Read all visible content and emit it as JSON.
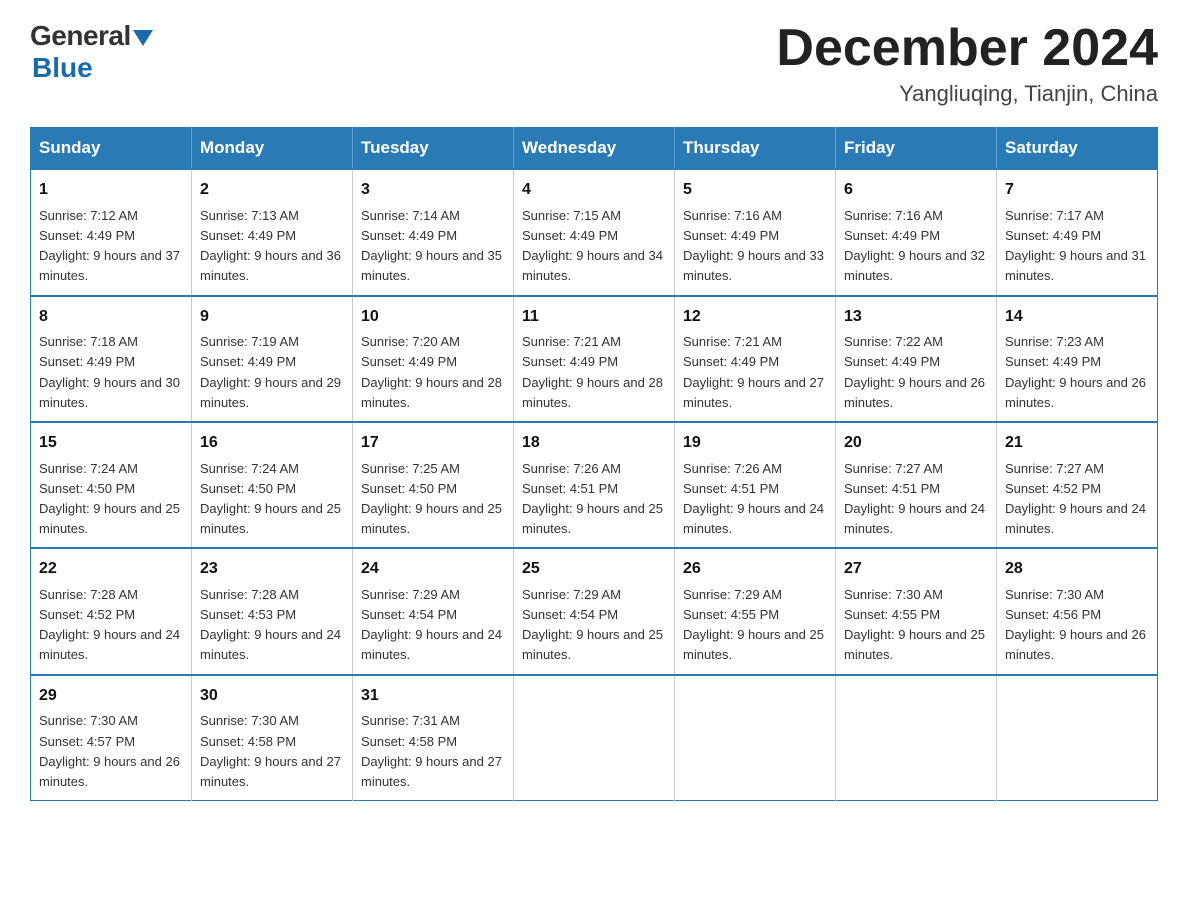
{
  "header": {
    "logo_general": "General",
    "logo_blue": "Blue",
    "month_title": "December 2024",
    "location": "Yangliuqing, Tianjin, China"
  },
  "days_of_week": [
    "Sunday",
    "Monday",
    "Tuesday",
    "Wednesday",
    "Thursday",
    "Friday",
    "Saturday"
  ],
  "weeks": [
    [
      {
        "day": "1",
        "sunrise": "7:12 AM",
        "sunset": "4:49 PM",
        "daylight": "9 hours and 37 minutes."
      },
      {
        "day": "2",
        "sunrise": "7:13 AM",
        "sunset": "4:49 PM",
        "daylight": "9 hours and 36 minutes."
      },
      {
        "day": "3",
        "sunrise": "7:14 AM",
        "sunset": "4:49 PM",
        "daylight": "9 hours and 35 minutes."
      },
      {
        "day": "4",
        "sunrise": "7:15 AM",
        "sunset": "4:49 PM",
        "daylight": "9 hours and 34 minutes."
      },
      {
        "day": "5",
        "sunrise": "7:16 AM",
        "sunset": "4:49 PM",
        "daylight": "9 hours and 33 minutes."
      },
      {
        "day": "6",
        "sunrise": "7:16 AM",
        "sunset": "4:49 PM",
        "daylight": "9 hours and 32 minutes."
      },
      {
        "day": "7",
        "sunrise": "7:17 AM",
        "sunset": "4:49 PM",
        "daylight": "9 hours and 31 minutes."
      }
    ],
    [
      {
        "day": "8",
        "sunrise": "7:18 AM",
        "sunset": "4:49 PM",
        "daylight": "9 hours and 30 minutes."
      },
      {
        "day": "9",
        "sunrise": "7:19 AM",
        "sunset": "4:49 PM",
        "daylight": "9 hours and 29 minutes."
      },
      {
        "day": "10",
        "sunrise": "7:20 AM",
        "sunset": "4:49 PM",
        "daylight": "9 hours and 28 minutes."
      },
      {
        "day": "11",
        "sunrise": "7:21 AM",
        "sunset": "4:49 PM",
        "daylight": "9 hours and 28 minutes."
      },
      {
        "day": "12",
        "sunrise": "7:21 AM",
        "sunset": "4:49 PM",
        "daylight": "9 hours and 27 minutes."
      },
      {
        "day": "13",
        "sunrise": "7:22 AM",
        "sunset": "4:49 PM",
        "daylight": "9 hours and 26 minutes."
      },
      {
        "day": "14",
        "sunrise": "7:23 AM",
        "sunset": "4:49 PM",
        "daylight": "9 hours and 26 minutes."
      }
    ],
    [
      {
        "day": "15",
        "sunrise": "7:24 AM",
        "sunset": "4:50 PM",
        "daylight": "9 hours and 25 minutes."
      },
      {
        "day": "16",
        "sunrise": "7:24 AM",
        "sunset": "4:50 PM",
        "daylight": "9 hours and 25 minutes."
      },
      {
        "day": "17",
        "sunrise": "7:25 AM",
        "sunset": "4:50 PM",
        "daylight": "9 hours and 25 minutes."
      },
      {
        "day": "18",
        "sunrise": "7:26 AM",
        "sunset": "4:51 PM",
        "daylight": "9 hours and 25 minutes."
      },
      {
        "day": "19",
        "sunrise": "7:26 AM",
        "sunset": "4:51 PM",
        "daylight": "9 hours and 24 minutes."
      },
      {
        "day": "20",
        "sunrise": "7:27 AM",
        "sunset": "4:51 PM",
        "daylight": "9 hours and 24 minutes."
      },
      {
        "day": "21",
        "sunrise": "7:27 AM",
        "sunset": "4:52 PM",
        "daylight": "9 hours and 24 minutes."
      }
    ],
    [
      {
        "day": "22",
        "sunrise": "7:28 AM",
        "sunset": "4:52 PM",
        "daylight": "9 hours and 24 minutes."
      },
      {
        "day": "23",
        "sunrise": "7:28 AM",
        "sunset": "4:53 PM",
        "daylight": "9 hours and 24 minutes."
      },
      {
        "day": "24",
        "sunrise": "7:29 AM",
        "sunset": "4:54 PM",
        "daylight": "9 hours and 24 minutes."
      },
      {
        "day": "25",
        "sunrise": "7:29 AM",
        "sunset": "4:54 PM",
        "daylight": "9 hours and 25 minutes."
      },
      {
        "day": "26",
        "sunrise": "7:29 AM",
        "sunset": "4:55 PM",
        "daylight": "9 hours and 25 minutes."
      },
      {
        "day": "27",
        "sunrise": "7:30 AM",
        "sunset": "4:55 PM",
        "daylight": "9 hours and 25 minutes."
      },
      {
        "day": "28",
        "sunrise": "7:30 AM",
        "sunset": "4:56 PM",
        "daylight": "9 hours and 26 minutes."
      }
    ],
    [
      {
        "day": "29",
        "sunrise": "7:30 AM",
        "sunset": "4:57 PM",
        "daylight": "9 hours and 26 minutes."
      },
      {
        "day": "30",
        "sunrise": "7:30 AM",
        "sunset": "4:58 PM",
        "daylight": "9 hours and 27 minutes."
      },
      {
        "day": "31",
        "sunrise": "7:31 AM",
        "sunset": "4:58 PM",
        "daylight": "9 hours and 27 minutes."
      },
      null,
      null,
      null,
      null
    ]
  ]
}
